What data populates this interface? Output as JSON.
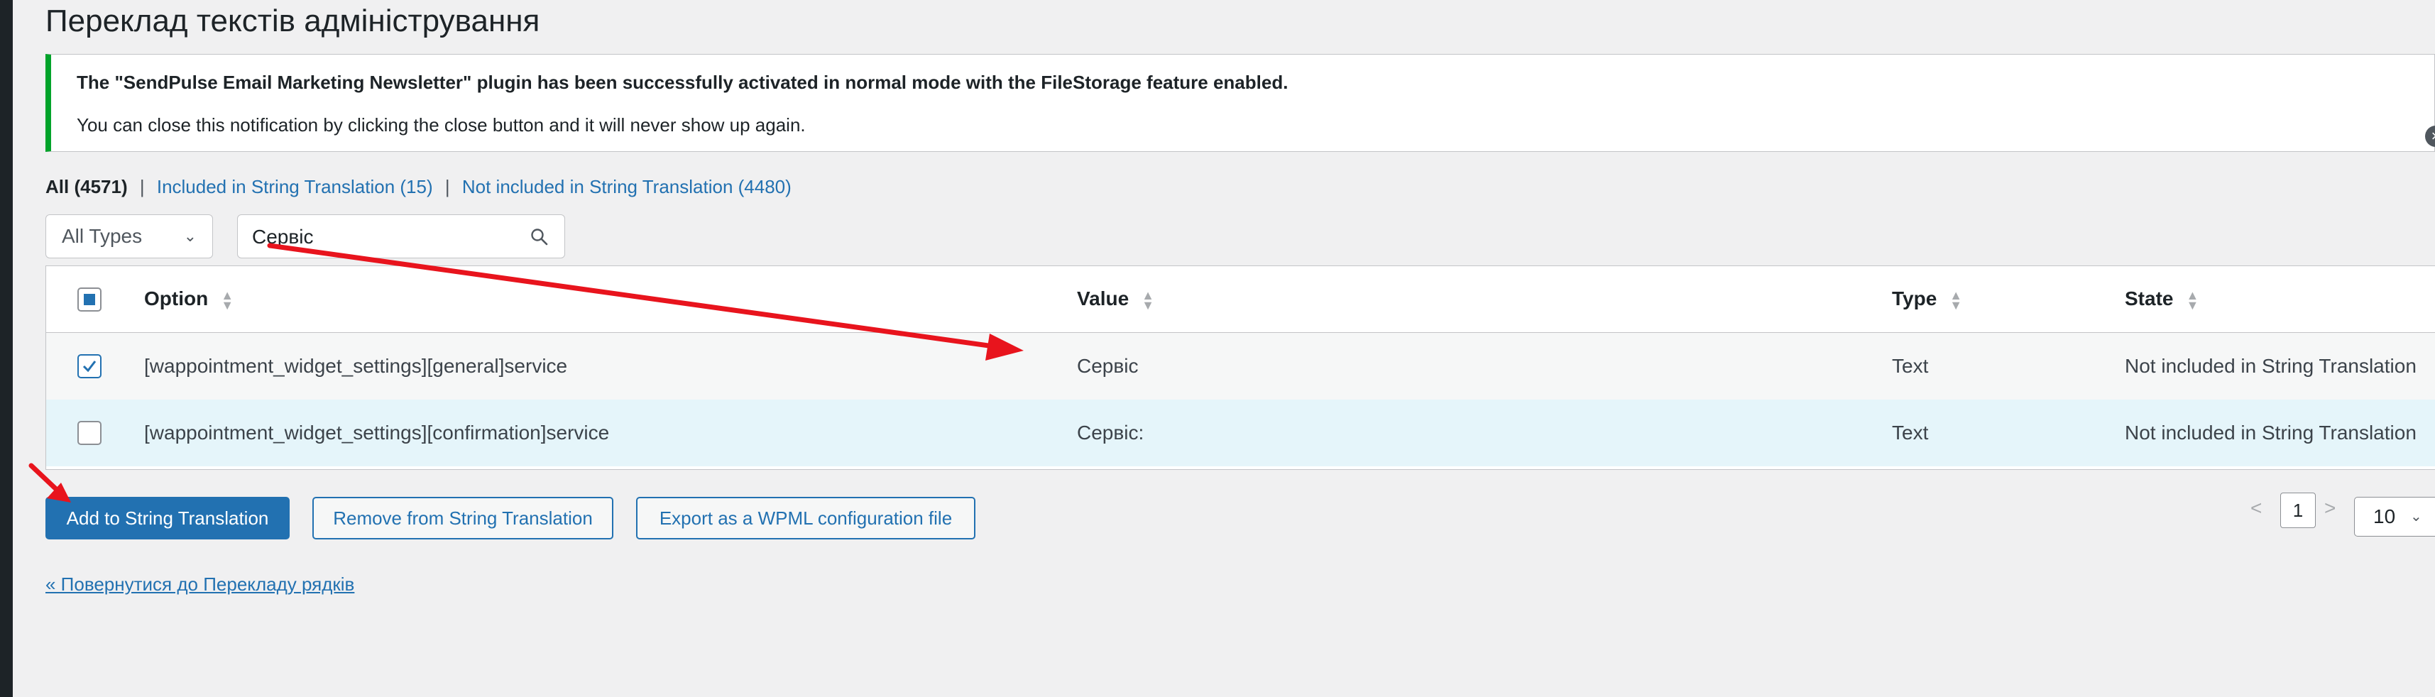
{
  "page": {
    "title": "Переклад текстів адміністрування"
  },
  "notice": {
    "title": "The \"SendPulse Email Marketing Newsletter\" plugin has been successfully activated in normal mode with the FileStorage feature enabled.",
    "text": "You can close this notification by clicking the close button and it will never show up again.",
    "close_glyph": "×"
  },
  "filters": {
    "all": "All (4571)",
    "included": "Included in String Translation (15)",
    "not_included": "Not included in String Translation (4480)",
    "separator": "|"
  },
  "type_select": {
    "value": "All Types"
  },
  "search": {
    "value": "Сервіс"
  },
  "table": {
    "headers": {
      "option": "Option",
      "value": "Value",
      "type": "Type",
      "state": "State"
    },
    "rows": [
      {
        "option": "[wappointment_widget_settings][general]service",
        "value": "Сервіс",
        "type": "Text",
        "state": "Not included in String Translation",
        "checked": true
      },
      {
        "option": "[wappointment_widget_settings][confirmation]service",
        "value": "Сервіс:",
        "type": "Text",
        "state": "Not included in String Translation",
        "checked": false
      }
    ]
  },
  "actions": {
    "add": "Add to String Translation",
    "remove": "Remove from String Translation",
    "export": "Export as a WPML configuration file"
  },
  "pagination": {
    "prev": "<",
    "page": "1",
    "next": ">",
    "per_page": "10"
  },
  "back_link": "« Повернутися до Перекладу рядків",
  "colors": {
    "accent": "#2271b1",
    "success_border": "#00a32a",
    "annotation_arrow": "#e8141d",
    "selected_row": "#e5f5fa"
  }
}
